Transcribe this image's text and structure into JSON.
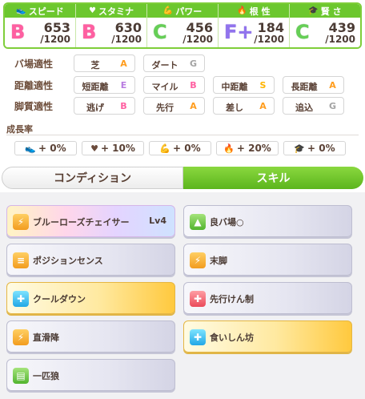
{
  "stats": [
    {
      "label": "スピード",
      "icon": "shoe-icon",
      "glyph": "👟",
      "rank": "B",
      "rank_class": "b",
      "value": "653",
      "max": "/1200"
    },
    {
      "label": "スタミナ",
      "icon": "heart-icon",
      "glyph": "♥",
      "rank": "B",
      "rank_class": "b",
      "value": "630",
      "max": "/1200"
    },
    {
      "label": "パワー",
      "icon": "muscle-icon",
      "glyph": "💪",
      "rank": "C",
      "rank_class": "c",
      "value": "456",
      "max": "/1200"
    },
    {
      "label": "根 性",
      "icon": "flame-icon",
      "glyph": "🔥",
      "rank": "F+",
      "rank_class": "fp",
      "value": "184",
      "max": "/1200"
    },
    {
      "label": "賢 さ",
      "icon": "graduation-cap-icon",
      "glyph": "🎓",
      "rank": "C",
      "rank_class": "c",
      "value": "439",
      "max": "/1200"
    }
  ],
  "aptitude": {
    "track": {
      "label": "バ場適性",
      "items": [
        {
          "name": "芝",
          "grade": "A"
        },
        {
          "name": "ダート",
          "grade": "G"
        }
      ]
    },
    "distance": {
      "label": "距離適性",
      "items": [
        {
          "name": "短距離",
          "grade": "E"
        },
        {
          "name": "マイル",
          "grade": "B"
        },
        {
          "name": "中距離",
          "grade": "S"
        },
        {
          "name": "長距離",
          "grade": "A"
        }
      ]
    },
    "style": {
      "label": "脚質適性",
      "items": [
        {
          "name": "逃げ",
          "grade": "B"
        },
        {
          "name": "先行",
          "grade": "A"
        },
        {
          "name": "差し",
          "grade": "A"
        },
        {
          "name": "追込",
          "grade": "G"
        }
      ]
    }
  },
  "growth": {
    "title": "成長率",
    "items": [
      {
        "icon": "shoe-icon",
        "glyph": "👟",
        "value": "+ 0%"
      },
      {
        "icon": "heart-icon",
        "glyph": "♥",
        "value": "+ 10%"
      },
      {
        "icon": "muscle-icon",
        "glyph": "💪",
        "value": "+ 0%"
      },
      {
        "icon": "flame-icon",
        "glyph": "🔥",
        "value": "+ 20%"
      },
      {
        "icon": "graduation-cap-icon",
        "glyph": "🎓",
        "value": "+ 0%"
      }
    ]
  },
  "tabs": {
    "condition": "コンディション",
    "skill": "スキル"
  },
  "skills": [
    {
      "name": "ブルーローズチェイサー",
      "level": "Lv4",
      "style": "rainbow",
      "icon_class": "ic-orange",
      "glyph": "⚡"
    },
    {
      "name": "良バ場○",
      "level": "",
      "style": "normal",
      "icon_class": "ic-green",
      "glyph": "▲"
    },
    {
      "name": "ポジションセンス",
      "level": "",
      "style": "normal",
      "icon_class": "ic-orange",
      "glyph": "≡"
    },
    {
      "name": "末脚",
      "level": "",
      "style": "normal",
      "icon_class": "ic-orange",
      "glyph": "⚡"
    },
    {
      "name": "クールダウン",
      "level": "",
      "style": "gold",
      "icon_class": "ic-blue",
      "glyph": "✚"
    },
    {
      "name": "先行けん制",
      "level": "",
      "style": "normal",
      "icon_class": "ic-red",
      "glyph": "✚"
    },
    {
      "name": "直滑降",
      "level": "",
      "style": "normal",
      "icon_class": "ic-orange",
      "glyph": "⚡"
    },
    {
      "name": "食いしん坊",
      "level": "",
      "style": "gold",
      "icon_class": "ic-blue",
      "glyph": "✚"
    },
    {
      "name": "一匹狼",
      "level": "",
      "style": "normal",
      "icon_class": "ic-green",
      "glyph": "▤"
    }
  ]
}
